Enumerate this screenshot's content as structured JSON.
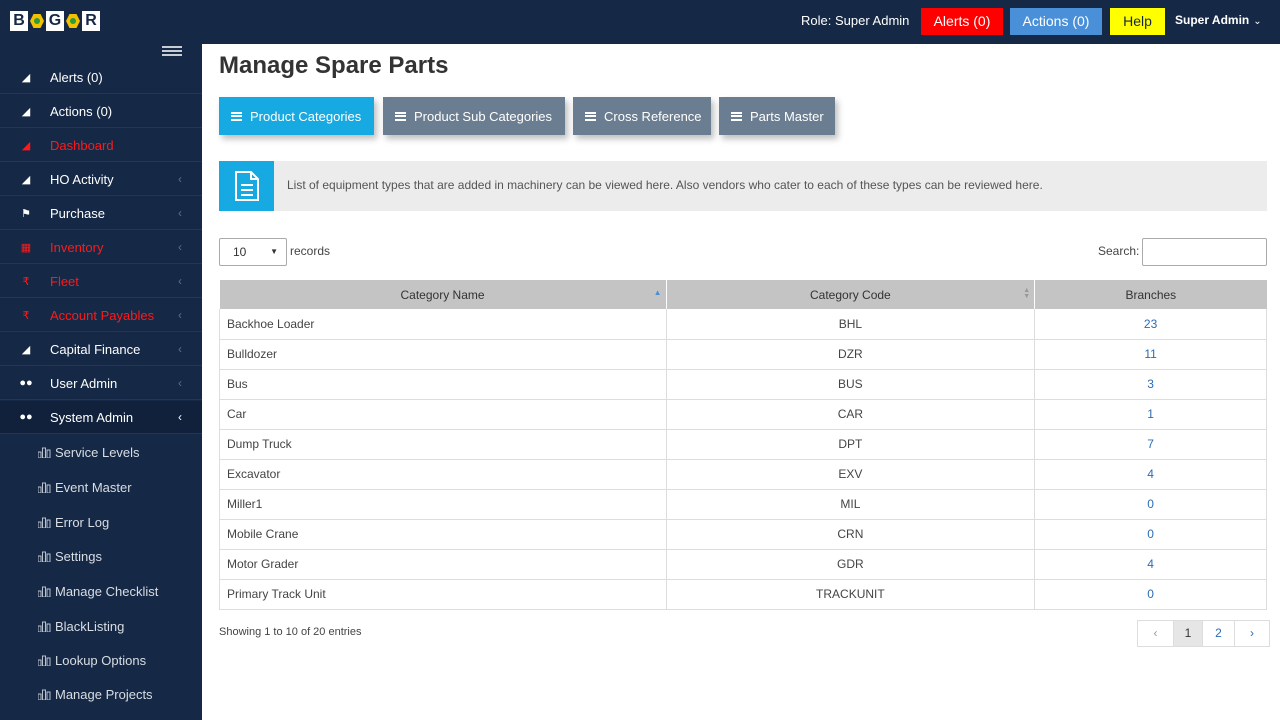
{
  "header": {
    "logo": "BGR",
    "role": "Role: Super Admin",
    "alerts_label": "Alerts (0)",
    "actions_label": "Actions (0)",
    "help_label": "Help",
    "user_label": "Super Admin"
  },
  "sidebar": {
    "items": [
      {
        "label": "Alerts (0)",
        "icon": "chart-area-icon"
      },
      {
        "label": "Actions (0)",
        "icon": "chart-area-icon"
      },
      {
        "label": "Dashboard",
        "icon": "chart-area-icon",
        "color": "#ff1a1a"
      },
      {
        "label": "HO Activity",
        "icon": "chart-area-icon"
      },
      {
        "label": "Purchase",
        "icon": "flag-icon"
      },
      {
        "label": "Inventory",
        "icon": "calculator-icon",
        "color": "#ff1a1a"
      },
      {
        "label": "Fleet",
        "icon": "rupee-icon",
        "color": "#ff1a1a"
      },
      {
        "label": "Account Payables",
        "icon": "rupee-icon",
        "color": "#ff1a1a"
      },
      {
        "label": "Capital Finance",
        "icon": "chart-area-icon"
      },
      {
        "label": "User Admin",
        "icon": "users-icon"
      },
      {
        "label": "System Admin",
        "icon": "users-icon"
      }
    ],
    "sub_items": [
      {
        "label": "Service Levels"
      },
      {
        "label": "Event Master"
      },
      {
        "label": "Error Log"
      },
      {
        "label": "Settings"
      },
      {
        "label": "Manage Checklist"
      },
      {
        "label": "BlackListing"
      },
      {
        "label": "Lookup Options"
      },
      {
        "label": "Manage Projects"
      }
    ]
  },
  "main": {
    "title": "Manage Spare Parts",
    "tabs": [
      {
        "label": "Product Categories"
      },
      {
        "label": "Product Sub Categories"
      },
      {
        "label": "Cross Reference"
      },
      {
        "label": "Parts Master"
      }
    ],
    "info_text": "List of equipment types that are added in machinery can be viewed here. Also vendors who cater to each of these types can be reviewed here.",
    "length_value": "10",
    "records_label": "records",
    "search_label": "Search:",
    "table": {
      "columns": [
        "Category Name",
        "Category Code",
        "Branches"
      ],
      "rows": [
        [
          "Backhoe Loader",
          "BHL",
          "23"
        ],
        [
          "Bulldozer",
          "DZR",
          "11"
        ],
        [
          "Bus",
          "BUS",
          "3"
        ],
        [
          "Car",
          "CAR",
          "1"
        ],
        [
          "Dump Truck",
          "DPT",
          "7"
        ],
        [
          "Excavator",
          "EXV",
          "4"
        ],
        [
          "Miller1",
          "MIL",
          "0"
        ],
        [
          "Mobile Crane",
          "CRN",
          "0"
        ],
        [
          "Motor Grader",
          "GDR",
          "4"
        ],
        [
          "Primary Track Unit",
          "TRACKUNIT",
          "0"
        ]
      ]
    },
    "showing_text": "Showing 1 to 10 of 20 entries",
    "pagination": {
      "prev": "‹",
      "pages": [
        "1",
        "2"
      ],
      "next": "›"
    }
  },
  "colors": {
    "navy": "#152845",
    "accent_blue": "#17a9e1",
    "tab_gray": "#6b7d91",
    "alert_red": "#ff0000",
    "help_yellow": "#ffff00"
  }
}
